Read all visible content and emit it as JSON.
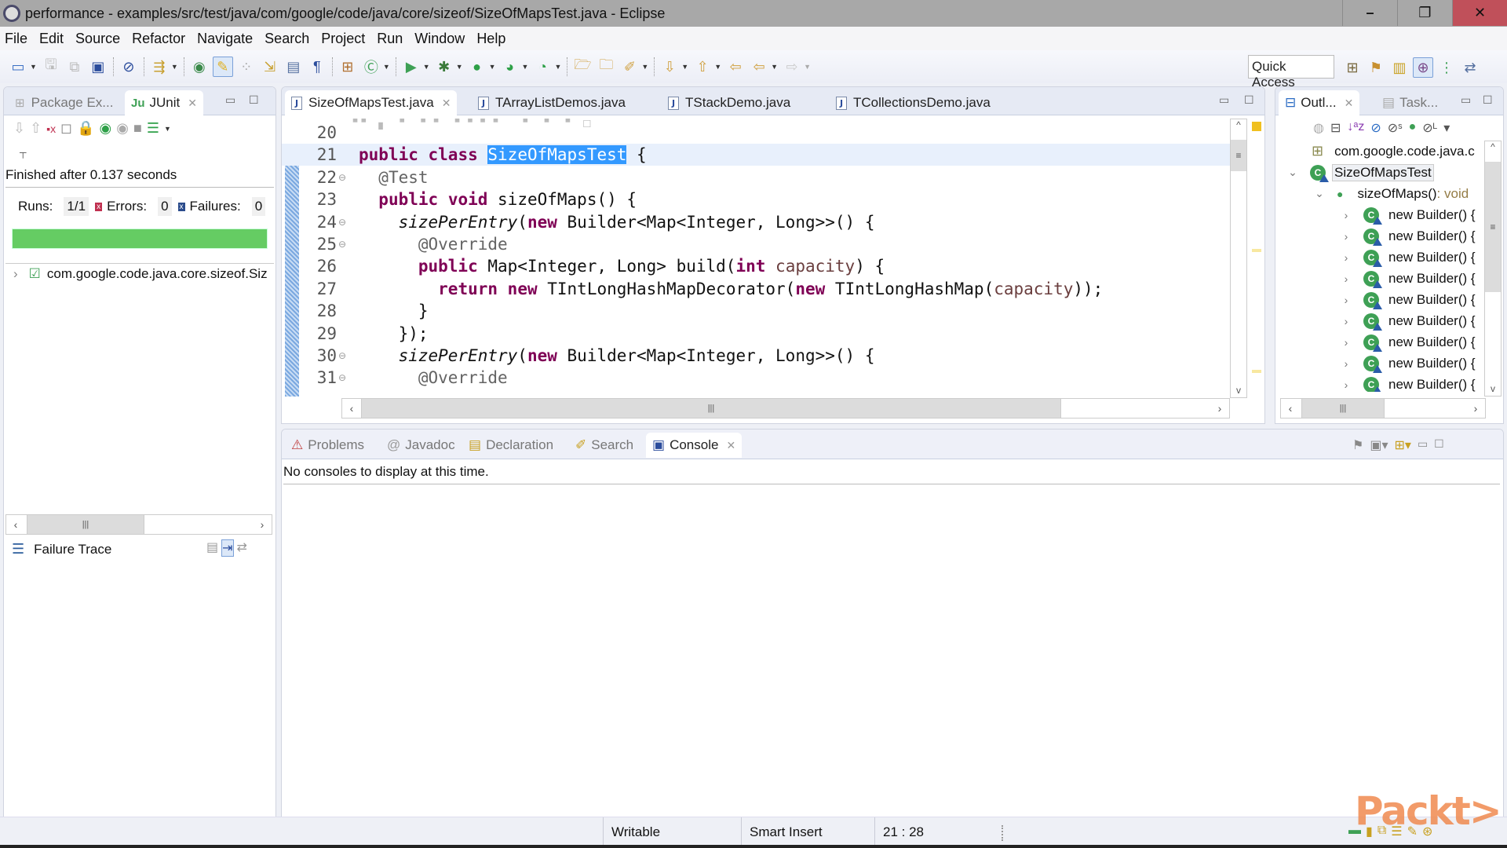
{
  "window": {
    "title": "performance - examples/src/test/java/com/google/code/java/core/sizeof/SizeOfMapsTest.java - Eclipse",
    "controls": {
      "minimize": "–",
      "restore": "❐",
      "close": "✕"
    }
  },
  "menu": [
    "File",
    "Edit",
    "Source",
    "Refactor",
    "Navigate",
    "Search",
    "Project",
    "Run",
    "Window",
    "Help"
  ],
  "toolbar": {
    "quick_access": "Quick Access",
    "icons": [
      "new-wizard-icon",
      "save-icon",
      "save-all-icon",
      "console-icon",
      "skip-breakpoints-icon",
      "refactor-icon",
      "open-type-icon",
      "toggle-mark-occurrences-icon",
      "show-whitespace-icon",
      "next-annotation-icon",
      "block-selection-icon",
      "show-invisibles-icon",
      "new-java-package-icon",
      "new-java-class-icon",
      "coverage-icon",
      "debug-icon",
      "run-icon",
      "run-external-icon",
      "run-ant-icon",
      "open-folder-icon",
      "open-task-icon",
      "search-pen-icon",
      "next-annotation-down-icon",
      "prev-annotation-up-icon",
      "last-edit-icon",
      "back-icon",
      "forward-icon"
    ],
    "perspectives": [
      "open-perspective-icon",
      "java-ee-icon",
      "git-icon",
      "java-icon",
      "java-browsing-icon",
      "debug-perspective-icon"
    ]
  },
  "left_panel": {
    "tabs": [
      {
        "label": "Package Ex...",
        "active": false
      },
      {
        "label": "JUnit",
        "active": true
      }
    ],
    "status": "Finished after 0.137 seconds",
    "runs_label": "Runs:",
    "runs_value": "1/1",
    "errors_label": "Errors:",
    "errors_value": "0",
    "failures_label": "Failures:",
    "failures_value": "0",
    "progress": 1.0,
    "progress_color": "#65cc63",
    "tree_item": "com.google.code.java.core.sizeof.Siz",
    "failure_trace_label": "Failure Trace"
  },
  "editor": {
    "tabs": [
      {
        "label": "SizeOfMapsTest.java",
        "active": true,
        "warning": true
      },
      {
        "label": "TArrayListDemos.java",
        "active": false
      },
      {
        "label": "TStackDemo.java",
        "active": false
      },
      {
        "label": "TCollectionsDemo.java",
        "active": false
      }
    ],
    "lines": [
      {
        "n": "20",
        "fold": false,
        "html": ""
      },
      {
        "n": "21",
        "fold": false,
        "html": "<span class='kw'>public</span> <span class='kw'>class</span> <span class='sel'>SizeOfMapsTest</span> {"
      },
      {
        "n": "22",
        "fold": true,
        "html": "  <span class='ann'>@Test</span>"
      },
      {
        "n": "23",
        "fold": false,
        "html": "  <span class='kw'>public</span> <span class='kw'>void</span> sizeOfMaps() {"
      },
      {
        "n": "24",
        "fold": true,
        "html": "    <span class='it'>sizePerEntry</span>(<span class='kw'>new</span> Builder&lt;Map&lt;Integer, Long&gt;&gt;() {"
      },
      {
        "n": "25",
        "fold": true,
        "html": "      <span class='ann'>@Override</span>"
      },
      {
        "n": "26",
        "fold": false,
        "html": "      <span class='kw'>public</span> Map&lt;Integer, Long&gt; build(<span class='kw'>int</span> <span class='param'>capacity</span>) {"
      },
      {
        "n": "27",
        "fold": false,
        "html": "        <span class='kw'>return</span> <span class='kw'>new</span> TIntLongHashMapDecorator(<span class='kw'>new</span> TIntLongHashMap(<span class='param'>capacity</span>));"
      },
      {
        "n": "28",
        "fold": false,
        "html": "      }"
      },
      {
        "n": "29",
        "fold": false,
        "html": "    });"
      },
      {
        "n": "30",
        "fold": true,
        "html": "    <span class='it'>sizePerEntry</span>(<span class='kw'>new</span> Builder&lt;Map&lt;Integer, Long&gt;&gt;() {"
      },
      {
        "n": "31",
        "fold": true,
        "html": "      <span class='ann'>@Override</span>"
      }
    ]
  },
  "outline": {
    "tabs": [
      {
        "label": "Outl...",
        "active": true
      },
      {
        "label": "Task...",
        "active": false
      }
    ],
    "items": [
      {
        "label": "com.google.code.java.c",
        "level": 0,
        "type": "import"
      },
      {
        "label": "SizeOfMapsTest",
        "level": 0,
        "type": "class",
        "expanded": true
      },
      {
        "label": "sizeOfMaps()",
        "suffix": " : void",
        "level": 1,
        "type": "method",
        "expanded": true
      },
      {
        "label": "new Builder() {",
        "level": 2,
        "type": "anon"
      },
      {
        "label": "new Builder() {",
        "level": 2,
        "type": "anon"
      },
      {
        "label": "new Builder() {",
        "level": 2,
        "type": "anon"
      },
      {
        "label": "new Builder() {",
        "level": 2,
        "type": "anon"
      },
      {
        "label": "new Builder() {",
        "level": 2,
        "type": "anon"
      },
      {
        "label": "new Builder() {",
        "level": 2,
        "type": "anon"
      },
      {
        "label": "new Builder() {",
        "level": 2,
        "type": "anon"
      },
      {
        "label": "new Builder() {",
        "level": 2,
        "type": "anon"
      },
      {
        "label": "new Builder() {",
        "level": 2,
        "type": "anon",
        "warning": true
      }
    ]
  },
  "bottom_panel": {
    "tabs": [
      {
        "label": "Problems",
        "active": false
      },
      {
        "label": "Javadoc",
        "active": false
      },
      {
        "label": "Declaration",
        "active": false
      },
      {
        "label": "Search",
        "active": false
      },
      {
        "label": "Console",
        "active": true
      }
    ],
    "message": "No consoles to display at this time."
  },
  "statusbar": {
    "writable": "Writable",
    "insert_mode": "Smart Insert",
    "cursor_position": "21 : 28"
  },
  "watermark": "Packt>"
}
